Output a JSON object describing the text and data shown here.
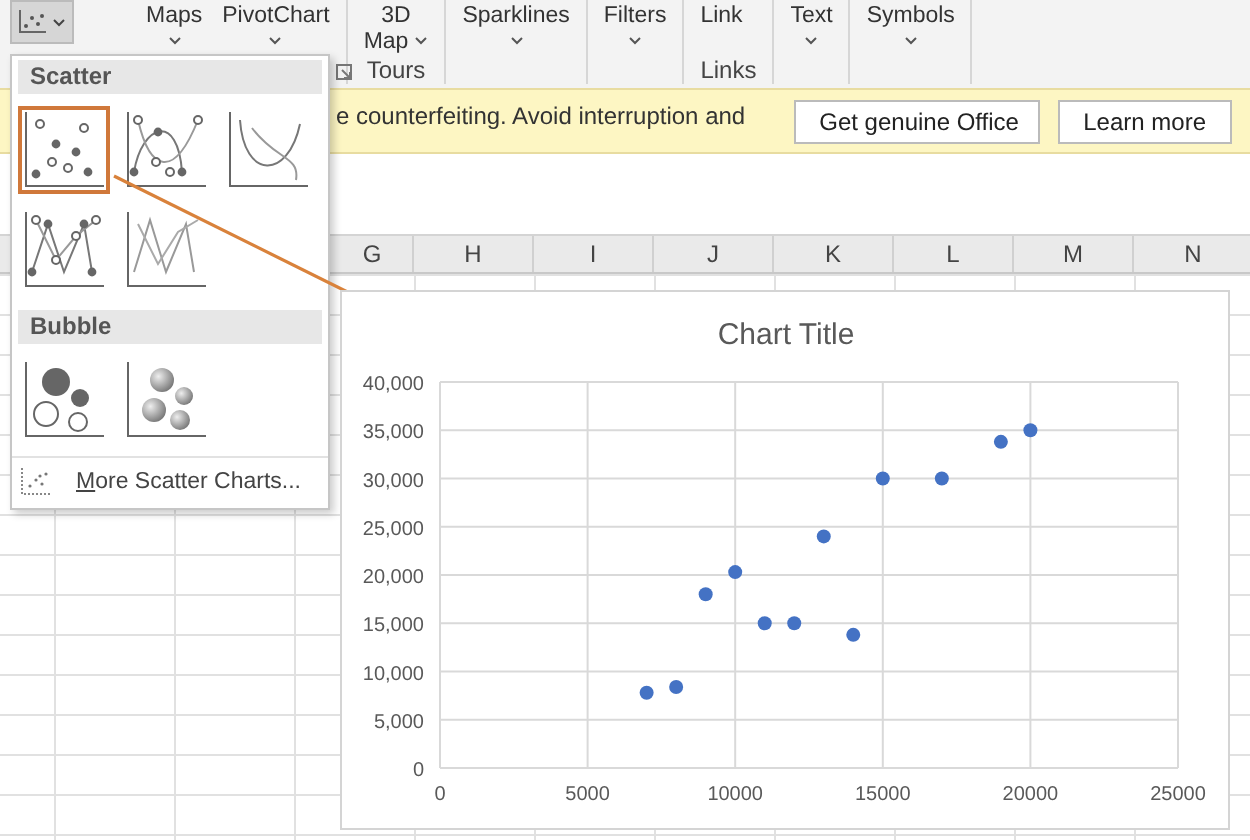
{
  "ribbon": {
    "chart_button": {
      "selected": true
    },
    "groups": [
      {
        "commands": [
          {
            "lines": [
              "Maps"
            ],
            "dropdown": true
          },
          {
            "lines": [
              "PivotChart"
            ],
            "dropdown": true
          }
        ],
        "launcher": true
      },
      {
        "commands": [
          {
            "lines": [
              "3D",
              "Map"
            ],
            "dropdown": true
          }
        ],
        "label": "Tours"
      },
      {
        "commands": [
          {
            "lines": [
              "Sparklines"
            ],
            "dropdown": true
          }
        ]
      },
      {
        "commands": [
          {
            "lines": [
              "Filters"
            ],
            "dropdown": true
          }
        ]
      },
      {
        "commands": [
          {
            "lines": [
              "Link"
            ],
            "dropdown": false
          }
        ],
        "label": "Links"
      },
      {
        "commands": [
          {
            "lines": [
              "Text"
            ],
            "dropdown": true
          }
        ]
      },
      {
        "commands": [
          {
            "lines": [
              "Symbols"
            ],
            "dropdown": true
          }
        ]
      }
    ]
  },
  "infobar": {
    "message": "e counterfeiting. Avoid interruption and",
    "buttons": [
      "Get genuine Office",
      "Learn more"
    ]
  },
  "column_headers": [
    "G",
    "H",
    "I",
    "J",
    "K",
    "L",
    "M",
    "N"
  ],
  "gallery": {
    "sections": [
      {
        "title": "Scatter",
        "items": [
          {
            "kind": "markers",
            "selected": true
          },
          {
            "kind": "smooth-markers",
            "selected": false
          },
          {
            "kind": "smooth-lines",
            "selected": false
          },
          {
            "kind": "straight-markers",
            "selected": false
          },
          {
            "kind": "straight-lines",
            "selected": false
          }
        ]
      },
      {
        "title": "Bubble",
        "items": [
          {
            "kind": "bubble",
            "selected": false
          },
          {
            "kind": "bubble-3d",
            "selected": false
          }
        ]
      }
    ],
    "more_link": "More Scatter Charts..."
  },
  "chart": {
    "chart_data": {
      "type": "scatter",
      "title": "Chart Title",
      "x": [
        7000,
        8000,
        9000,
        10000,
        11000,
        12000,
        13000,
        14000,
        15000,
        17000,
        19000,
        20000
      ],
      "series": [
        {
          "color": "#4472c4",
          "values": [
            7800,
            8400,
            18000,
            20300,
            15000,
            15000,
            24000,
            13800,
            30000,
            30000,
            33800,
            35000
          ]
        }
      ],
      "grid": true,
      "xlim": [
        0,
        25000
      ],
      "ylim": [
        0,
        40000
      ],
      "xticks": [
        0,
        5000,
        10000,
        15000,
        20000,
        25000
      ],
      "yticks": [
        0,
        {
          "value": 5000,
          "label": "5,000"
        },
        {
          "value": 10000,
          "label": "10,000"
        },
        {
          "value": 15000,
          "label": "15,000"
        },
        {
          "value": 20000,
          "label": "20,000"
        },
        {
          "value": 25000,
          "label": "25,000"
        },
        {
          "value": 30000,
          "label": "30,000"
        },
        {
          "value": 35000,
          "label": "35,000"
        },
        {
          "value": 40000,
          "label": "40,000"
        }
      ]
    }
  }
}
